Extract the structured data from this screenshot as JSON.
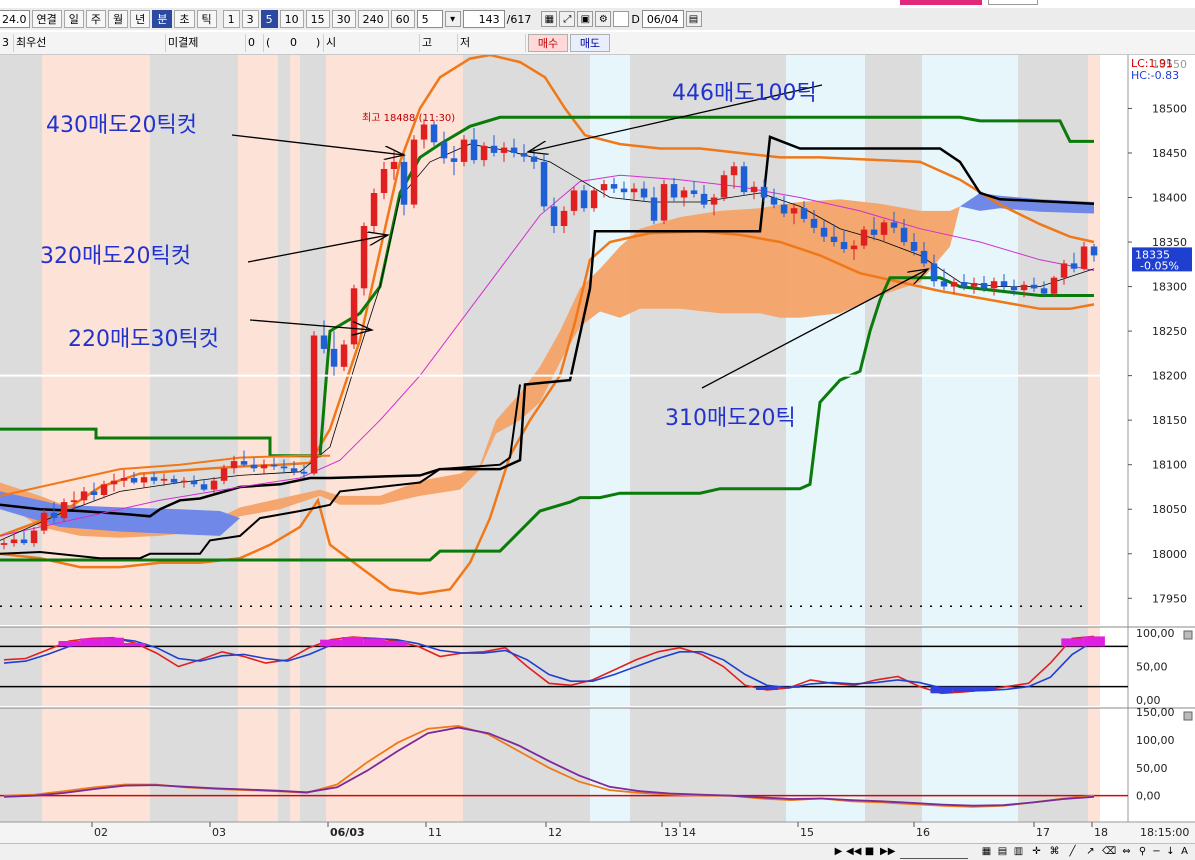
{
  "toolbar": {
    "year_fragment": "24.0",
    "tabs": [
      "연결",
      "일",
      "주",
      "월",
      "년",
      "분",
      "초",
      "틱"
    ],
    "active_tab": "분",
    "intervals": [
      "1",
      "3",
      "5",
      "10",
      "15",
      "30",
      "240",
      "60"
    ],
    "active_interval": "5",
    "period_value": "5",
    "count_value": "143",
    "count_total": "/617",
    "d_label": "D",
    "date_value": "06/04"
  },
  "info_bar": {
    "code_fragment": "3",
    "product": "최우선",
    "unsettled_label": "미결제",
    "unsettled_value": "0",
    "paren_open": "(",
    "paren_value": "0",
    "paren_close": ")",
    "open_label": "시",
    "high_label": "고",
    "low_label": "저",
    "buy_button": "매수",
    "sell_button": "매도"
  },
  "annotations": {
    "a430": "430매도20틱컷",
    "a446": "446매도100틱",
    "a320": "320매도20틱컷",
    "a220": "220매도30틱컷",
    "a310": "310매도20틱"
  },
  "colors": {
    "pink_zone": "#fde2d8",
    "cyan_zone": "#e6f6fb",
    "gray_zone": "#dcdcdc",
    "bull": "#e02020",
    "bear": "#1f5fd6",
    "bollinger": "#f07818",
    "channel_green": "#0a7a0a",
    "base_black": "#000000",
    "ma_magenta": "#d030d0",
    "cloud_orange": "#f5a060",
    "cloud_blue": "#7088e8",
    "annotation": "#2233cc"
  },
  "chart_data": {
    "type": "candlestick",
    "interval": "5분",
    "x_ticks": [
      "02",
      "03",
      "06/03",
      "11",
      "12",
      "13",
      "14",
      "15",
      "16",
      "17",
      "18"
    ],
    "time_label": "18:15:00",
    "ylim": [
      17920,
      18560
    ],
    "y_ticks": [
      18500,
      18450,
      18400,
      18350,
      18300,
      18250,
      18200,
      18150,
      18100,
      18050,
      18000,
      17950
    ],
    "high_label": "최고 18488 (11:30)",
    "last_price": "18335",
    "last_change": "-0.05%",
    "lc_label": "LC:1.91",
    "hc_label": "HC:-0.83",
    "top_partial": "18550",
    "candles": [
      [
        18010,
        18018,
        18005,
        18012
      ],
      [
        18012,
        18022,
        18008,
        18016
      ],
      [
        18016,
        18025,
        18010,
        18012
      ],
      [
        18012,
        18030,
        18008,
        18026
      ],
      [
        18026,
        18050,
        18022,
        18046
      ],
      [
        18046,
        18058,
        18035,
        18040
      ],
      [
        18040,
        18062,
        18036,
        18058
      ],
      [
        18058,
        18070,
        18050,
        18060
      ],
      [
        18060,
        18075,
        18055,
        18070
      ],
      [
        18070,
        18080,
        18060,
        18066
      ],
      [
        18066,
        18082,
        18062,
        18078
      ],
      [
        18078,
        18090,
        18070,
        18082
      ],
      [
        18082,
        18094,
        18075,
        18085
      ],
      [
        18085,
        18092,
        18078,
        18080
      ],
      [
        18080,
        18090,
        18074,
        18086
      ],
      [
        18086,
        18092,
        18078,
        18082
      ],
      [
        18082,
        18090,
        18076,
        18084
      ],
      [
        18084,
        18088,
        18078,
        18080
      ],
      [
        18080,
        18086,
        18074,
        18082
      ],
      [
        18082,
        18088,
        18075,
        18078
      ],
      [
        18078,
        18084,
        18070,
        18072
      ],
      [
        18072,
        18086,
        18068,
        18082
      ],
      [
        18082,
        18100,
        18078,
        18096
      ],
      [
        18096,
        18110,
        18090,
        18104
      ],
      [
        18104,
        18116,
        18098,
        18100
      ],
      [
        18100,
        18108,
        18092,
        18096
      ],
      [
        18096,
        18106,
        18090,
        18100
      ],
      [
        18100,
        18108,
        18094,
        18098
      ],
      [
        18098,
        18106,
        18090,
        18096
      ],
      [
        18096,
        18104,
        18088,
        18092
      ],
      [
        18092,
        18100,
        18085,
        18090
      ],
      [
        18090,
        18250,
        18088,
        18245
      ],
      [
        18245,
        18262,
        18225,
        18230
      ],
      [
        18230,
        18250,
        18200,
        18210
      ],
      [
        18210,
        18240,
        18205,
        18235
      ],
      [
        18235,
        18302,
        18230,
        18298
      ],
      [
        18298,
        18372,
        18290,
        18368
      ],
      [
        18368,
        18410,
        18360,
        18405
      ],
      [
        18405,
        18440,
        18398,
        18432
      ],
      [
        18432,
        18452,
        18420,
        18440
      ],
      [
        18440,
        18450,
        18380,
        18392
      ],
      [
        18392,
        18470,
        18388,
        18465
      ],
      [
        18465,
        18488,
        18455,
        18482
      ],
      [
        18482,
        18486,
        18458,
        18462
      ],
      [
        18462,
        18474,
        18438,
        18444
      ],
      [
        18444,
        18458,
        18425,
        18440
      ],
      [
        18440,
        18470,
        18435,
        18465
      ],
      [
        18465,
        18478,
        18438,
        18442
      ],
      [
        18442,
        18462,
        18435,
        18458
      ],
      [
        18458,
        18470,
        18446,
        18450
      ],
      [
        18450,
        18462,
        18440,
        18456
      ],
      [
        18456,
        18466,
        18445,
        18450
      ],
      [
        18450,
        18460,
        18440,
        18446
      ],
      [
        18446,
        18456,
        18432,
        18440
      ],
      [
        18440,
        18448,
        18385,
        18390
      ],
      [
        18390,
        18400,
        18360,
        18368
      ],
      [
        18368,
        18390,
        18360,
        18385
      ],
      [
        18385,
        18412,
        18380,
        18408
      ],
      [
        18408,
        18414,
        18384,
        18388
      ],
      [
        18388,
        18412,
        18384,
        18408
      ],
      [
        18408,
        18420,
        18400,
        18415
      ],
      [
        18415,
        18422,
        18405,
        18410
      ],
      [
        18410,
        18418,
        18398,
        18406
      ],
      [
        18406,
        18416,
        18398,
        18410
      ],
      [
        18410,
        18418,
        18395,
        18400
      ],
      [
        18400,
        18412,
        18370,
        18374
      ],
      [
        18374,
        18420,
        18370,
        18415
      ],
      [
        18415,
        18422,
        18396,
        18400
      ],
      [
        18400,
        18412,
        18390,
        18408
      ],
      [
        18408,
        18418,
        18400,
        18404
      ],
      [
        18404,
        18414,
        18388,
        18392
      ],
      [
        18392,
        18404,
        18380,
        18400
      ],
      [
        18400,
        18430,
        18396,
        18425
      ],
      [
        18425,
        18440,
        18410,
        18435
      ],
      [
        18435,
        18440,
        18402,
        18406
      ],
      [
        18406,
        18418,
        18398,
        18412
      ],
      [
        18412,
        18420,
        18395,
        18400
      ],
      [
        18400,
        18410,
        18388,
        18392
      ],
      [
        18392,
        18402,
        18378,
        18382
      ],
      [
        18382,
        18394,
        18370,
        18388
      ],
      [
        18388,
        18396,
        18372,
        18376
      ],
      [
        18376,
        18386,
        18360,
        18366
      ],
      [
        18366,
        18374,
        18350,
        18356
      ],
      [
        18356,
        18370,
        18345,
        18350
      ],
      [
        18350,
        18364,
        18338,
        18342
      ],
      [
        18342,
        18352,
        18330,
        18346
      ],
      [
        18346,
        18368,
        18342,
        18364
      ],
      [
        18364,
        18378,
        18352,
        18358
      ],
      [
        18358,
        18375,
        18350,
        18372
      ],
      [
        18372,
        18384,
        18360,
        18366
      ],
      [
        18366,
        18376,
        18346,
        18350
      ],
      [
        18350,
        18360,
        18335,
        18340
      ],
      [
        18340,
        18350,
        18322,
        18326
      ],
      [
        18326,
        18336,
        18300,
        18306
      ],
      [
        18306,
        18320,
        18296,
        18300
      ],
      [
        18300,
        18310,
        18292,
        18305
      ],
      [
        18305,
        18314,
        18296,
        18300
      ],
      [
        18300,
        18310,
        18292,
        18304
      ],
      [
        18304,
        18312,
        18294,
        18298
      ],
      [
        18298,
        18310,
        18290,
        18306
      ],
      [
        18306,
        18314,
        18296,
        18300
      ],
      [
        18300,
        18308,
        18290,
        18296
      ],
      [
        18296,
        18306,
        18288,
        18302
      ],
      [
        18302,
        18310,
        18294,
        18298
      ],
      [
        18298,
        18306,
        18288,
        18292
      ],
      [
        18292,
        18312,
        18288,
        18310
      ],
      [
        18310,
        18330,
        18302,
        18326
      ],
      [
        18326,
        18338,
        18316,
        18320
      ],
      [
        18320,
        18350,
        18318,
        18345
      ],
      [
        18345,
        18348,
        18328,
        18335
      ]
    ],
    "panel2": {
      "ylim": [
        0,
        100
      ],
      "y_ticks": [
        "100,00",
        "50,00",
        "0,00"
      ],
      "ref_lines": [
        80,
        20
      ],
      "series": [
        {
          "color": "#e02020",
          "values": [
            60,
            62,
            75,
            88,
            92,
            93,
            85,
            70,
            50,
            60,
            72,
            65,
            55,
            60,
            78,
            90,
            94,
            92,
            88,
            80,
            65,
            70,
            72,
            78,
            50,
            25,
            22,
            30,
            45,
            60,
            72,
            78,
            68,
            50,
            22,
            15,
            18,
            30,
            25,
            22,
            30,
            35,
            20,
            10,
            12,
            15,
            20,
            25,
            55,
            92,
            95
          ]
        },
        {
          "color": "#1f3fd0",
          "values": [
            55,
            58,
            68,
            80,
            88,
            92,
            88,
            78,
            62,
            58,
            66,
            68,
            62,
            58,
            68,
            82,
            90,
            92,
            90,
            84,
            74,
            70,
            70,
            74,
            60,
            38,
            28,
            28,
            38,
            50,
            62,
            72,
            72,
            60,
            38,
            22,
            18,
            24,
            26,
            24,
            26,
            30,
            26,
            18,
            14,
            14,
            16,
            20,
            34,
            68,
            88
          ]
        }
      ]
    },
    "panel3": {
      "ylim": [
        -40,
        150
      ],
      "y_ticks": [
        "150,00",
        "100,00",
        "50,00",
        "0,00"
      ],
      "zero_line": 0,
      "series": [
        {
          "color": "#f07818",
          "values": [
            0,
            2,
            8,
            15,
            20,
            20,
            15,
            12,
            10,
            8,
            5,
            20,
            60,
            95,
            120,
            125,
            110,
            80,
            50,
            25,
            10,
            5,
            2,
            0,
            0,
            -5,
            -8,
            -5,
            -10,
            -12,
            -15,
            -18,
            -20,
            -18,
            -12,
            -5,
            0
          ]
        },
        {
          "color": "#7a2a9a",
          "values": [
            -2,
            0,
            5,
            12,
            18,
            19,
            16,
            13,
            11,
            9,
            6,
            15,
            45,
            80,
            112,
            122,
            112,
            90,
            62,
            36,
            16,
            8,
            4,
            2,
            0,
            -3,
            -6,
            -5,
            -8,
            -10,
            -13,
            -16,
            -18,
            -17,
            -12,
            -6,
            -2
          ]
        }
      ]
    }
  }
}
